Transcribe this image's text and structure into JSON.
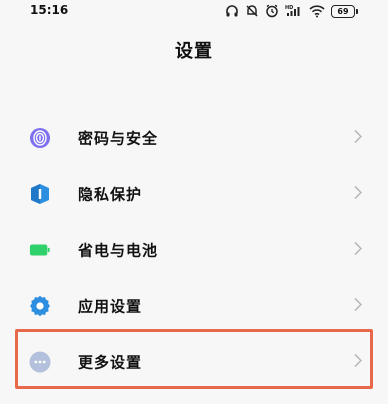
{
  "status_bar": {
    "time": "15:16",
    "battery_level": "69",
    "icons": [
      "headphones-icon",
      "mute-icon",
      "alarm-icon",
      "hd-signal-icon",
      "wifi-icon",
      "battery-icon"
    ]
  },
  "header": {
    "title": "设置"
  },
  "menu": {
    "items": [
      {
        "label": "密码与安全",
        "icon": "fingerprint-icon",
        "icon_color": "#7d6ff0"
      },
      {
        "label": "隐私保护",
        "icon": "privacy-shield-icon",
        "icon_color": "#2d8fe0"
      },
      {
        "label": "省电与电池",
        "icon": "battery-saver-icon",
        "icon_color": "#2fd16a"
      },
      {
        "label": "应用设置",
        "icon": "gear-icon",
        "icon_color": "#2e8fe0"
      },
      {
        "label": "更多设置",
        "icon": "more-dots-icon",
        "icon_color": "#b4c1dc"
      }
    ]
  },
  "highlight_color": "#e8694a"
}
